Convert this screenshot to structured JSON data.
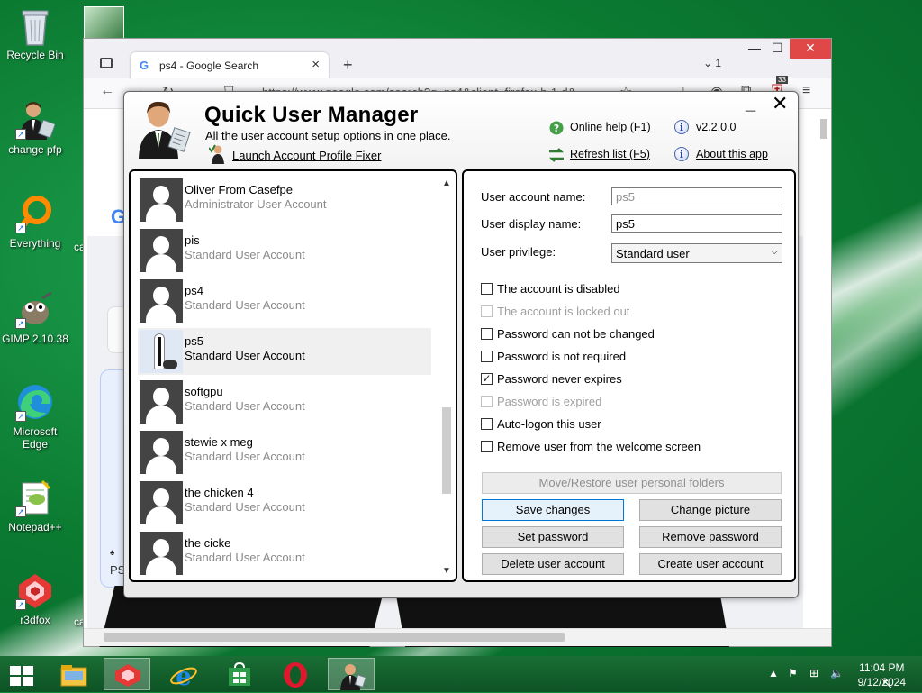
{
  "desktop": {
    "icons": [
      {
        "label": "Recycle Bin",
        "icon": "recycle-bin-icon"
      },
      {
        "label": "change pfp",
        "icon": "user-manager-icon"
      },
      {
        "label": "Everything",
        "icon": "everything-search-icon"
      },
      {
        "label": "GIMP 2.10.38",
        "icon": "gimp-icon"
      },
      {
        "label": "Microsoft Edge",
        "icon": "edge-icon"
      },
      {
        "label": "Notepad++",
        "icon": "notepadpp-icon"
      },
      {
        "label": "r3dfox",
        "icon": "r3dfox-icon"
      }
    ],
    "partial_labels": [
      "ca",
      "ca"
    ]
  },
  "browser": {
    "tab_title": "ps4 - Google Search",
    "tab_count": "1",
    "url": "https://www.google.com/search?q=ps4&client=firefox-b-1-d&",
    "extension_badge": "33",
    "page_snippet_1": "PS",
    "page_snippet_2": "P"
  },
  "qum": {
    "title": "Quick User Manager",
    "subtitle": "All the user account setup options in one place.",
    "launch_link": "Launch Account Profile Fixer",
    "online_help": "Online help (F1)",
    "version": "v2.2.0.0",
    "refresh_list": "Refresh list (F5)",
    "about": "About this app",
    "minimize": "_",
    "close": "✕",
    "users": [
      {
        "name": "Oliver From Casefpe",
        "type": "Administrator User Account",
        "selected": false
      },
      {
        "name": "pis",
        "type": "Standard User Account",
        "selected": false
      },
      {
        "name": "ps4",
        "type": "Standard User Account",
        "selected": false
      },
      {
        "name": "ps5",
        "type": "Standard User Account",
        "selected": true
      },
      {
        "name": "softgpu",
        "type": "Standard User Account",
        "selected": false
      },
      {
        "name": "stewie x meg",
        "type": "Standard User Account",
        "selected": false
      },
      {
        "name": "the chicken 4",
        "type": "Standard User Account",
        "selected": false
      },
      {
        "name": "the cicke",
        "type": "Standard User Account",
        "selected": false
      }
    ],
    "details": {
      "account_name_label": "User account name:",
      "account_name_value": "ps5",
      "display_name_label": "User display name:",
      "display_name_value": "ps5",
      "privilege_label": "User privilege:",
      "privilege_value": "Standard user",
      "checkboxes": [
        {
          "label": "The account is disabled",
          "checked": false,
          "disabled": false
        },
        {
          "label": "The account is locked out",
          "checked": false,
          "disabled": true
        },
        {
          "label": "Password can not be changed",
          "checked": false,
          "disabled": false
        },
        {
          "label": "Password is not required",
          "checked": false,
          "disabled": false
        },
        {
          "label": "Password never expires",
          "checked": true,
          "disabled": false
        },
        {
          "label": "Password is expired",
          "checked": false,
          "disabled": true
        },
        {
          "label": "Auto-logon this user",
          "checked": false,
          "disabled": false
        },
        {
          "label": "Remove user from the welcome screen",
          "checked": false,
          "disabled": false
        }
      ],
      "buttons": {
        "move_restore": "Move/Restore user personal folders",
        "save": "Save changes",
        "change_picture": "Change picture",
        "set_password": "Set password",
        "remove_password": "Remove password",
        "delete_user": "Delete user account",
        "create_user": "Create user account"
      }
    }
  },
  "taskbar": {
    "apps": [
      "file-explorer-icon",
      "r3dfox-icon",
      "internet-explorer-icon",
      "store-icon",
      "opera-icon",
      "user-manager-icon"
    ],
    "time": "11:04 PM",
    "date": "9/12/2024"
  },
  "colors": {
    "desktop_green": "#0b7a31",
    "selection_gray": "#f0f0f0",
    "primary_button_border": "#0078d7"
  }
}
